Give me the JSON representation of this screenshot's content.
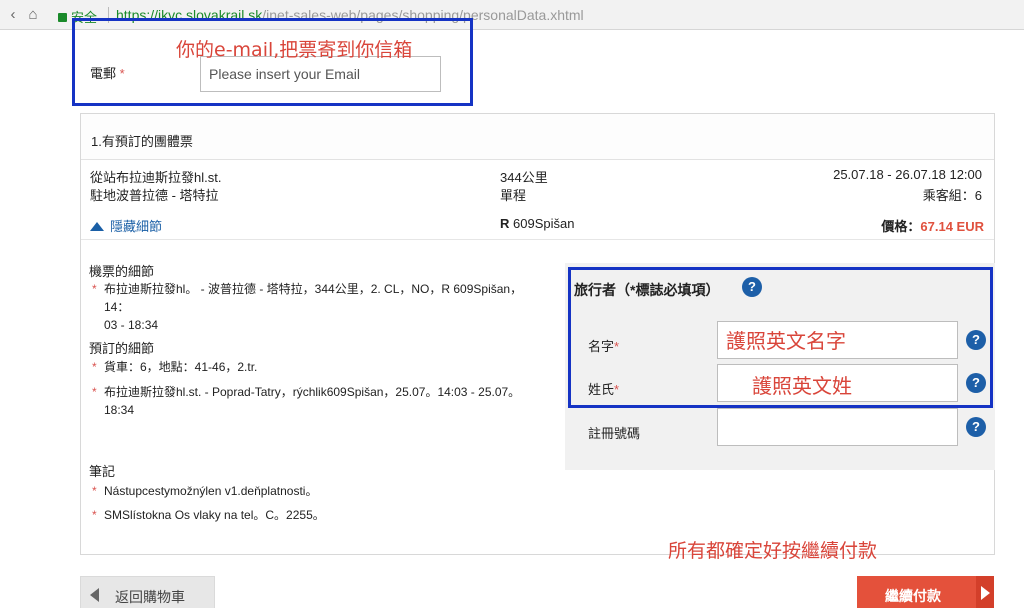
{
  "browser": {
    "secure_label": "安全",
    "url_host": "https://ikvc.slovakrail.sk",
    "url_path": "/inet-sales-web/pages/shopping/personalData.xhtml"
  },
  "email": {
    "label": "電郵",
    "required_mark": "*",
    "placeholder": "Please insert your Email"
  },
  "annotations": {
    "email_note": "你的e-mail,把票寄到你信箱",
    "firstname_note": "護照英文名字",
    "lastname_note": "護照英文姓",
    "bottom_note": "所有都確定好按繼續付款"
  },
  "ticket": {
    "title": "1.有預訂的團體票",
    "from": "從站布拉迪斯拉發hl.st.",
    "to": "駐地波普拉德 - 塔特拉",
    "distance": "344公里",
    "trip_type": "單程",
    "dates": "25.07.18 - 26.07.18 12:00",
    "passenger_group": "乘客組：6",
    "hide_details": "隱藏細節",
    "train": "R 609Spišan",
    "train_code": "R",
    "train_name": "609Spišan",
    "price_label": "價格：",
    "price_value": "67.14 EUR"
  },
  "details": {
    "ticket_title": "機票的細節",
    "ticket_line1": "布拉迪斯拉發hl。 - 波普拉德 - 塔特拉，344公里，2. CL，NO，R 609Spišan，14：",
    "ticket_line2": "03 - 18:34",
    "booking_title": "預訂的細節",
    "booking_item1": "貨車：6，地點：41-46，2.tr.",
    "booking_item2_line1": "布拉迪斯拉發hl.st. - Poprad-Tatry，rýchlik609Spišan，25.07。14:03 - 25.07。",
    "booking_item2_line2": "18:34",
    "notes_title": "筆記",
    "note1": "Nástupcestymožnýlen v1.deňplatnosti。",
    "note2": "SMSlístokna Os vlaky na tel。C。2255。"
  },
  "traveler": {
    "title": "旅行者（*標誌必填項）",
    "first_name_label": "名字",
    "last_name_label": "姓氏",
    "reg_number_label": "註冊號碼",
    "required_mark": "*",
    "help_glyph": "?"
  },
  "buttons": {
    "back": "返回購物車",
    "continue": "繼續付款"
  },
  "colors": {
    "accent_blue": "#1a5fa6",
    "annotation_red": "#d9453a",
    "annotation_box": "#1533c4",
    "continue_button": "#e4513b",
    "secure_green": "#1a8a2a"
  }
}
